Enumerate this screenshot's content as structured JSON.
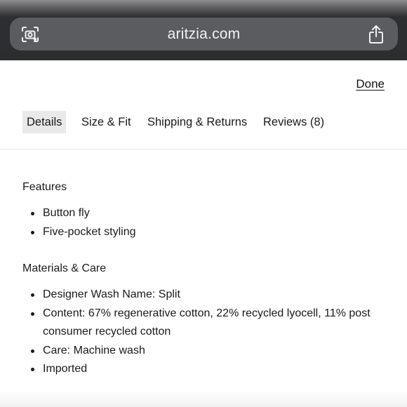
{
  "browser": {
    "url": "aritzia.com",
    "left_icon": "visual-lookup-camera-icon",
    "right_icon": "share-icon"
  },
  "panel": {
    "done_label": "Done",
    "tabs": [
      {
        "label": "Details",
        "active": true
      },
      {
        "label": "Size & Fit",
        "active": false
      },
      {
        "label": "Shipping & Returns",
        "active": false
      },
      {
        "label": "Reviews (8)",
        "active": false
      }
    ]
  },
  "details": {
    "features_title": "Features",
    "features": [
      "Button fly",
      "Five-pocket styling"
    ],
    "materials_title": "Materials & Care",
    "materials": [
      "Designer Wash Name: Split",
      "Content: 67% regenerative cotton, 22% recycled lyocell, 11% post consumer recycled cotton",
      "Care: Machine wash",
      "Imported"
    ]
  },
  "colors": {
    "browser_bar": "#2c2d2f",
    "url_pill": "#5b5c60",
    "active_tab_bg": "#e9e9e9"
  }
}
